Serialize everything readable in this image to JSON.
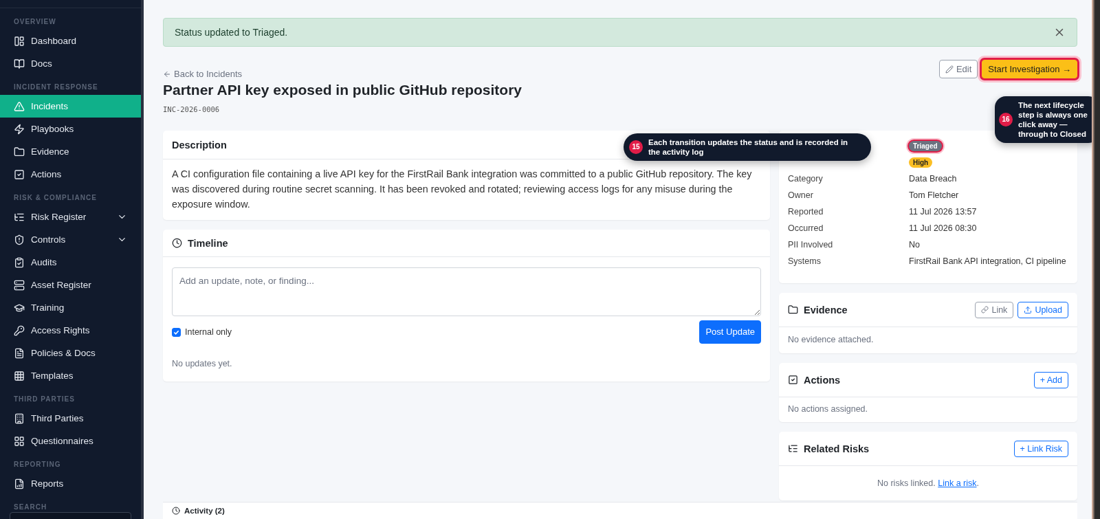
{
  "sidebar": {
    "sections": [
      {
        "title": "OVERVIEW",
        "items": [
          {
            "label": "Dashboard",
            "selected": false
          },
          {
            "label": "Docs",
            "selected": false
          }
        ]
      },
      {
        "title": "INCIDENT RESPONSE",
        "items": [
          {
            "label": "Incidents",
            "selected": true
          },
          {
            "label": "Playbooks",
            "selected": false
          },
          {
            "label": "Evidence",
            "selected": false
          },
          {
            "label": "Actions",
            "selected": false
          }
        ]
      },
      {
        "title": "RISK & COMPLIANCE",
        "items": [
          {
            "label": "Risk Register",
            "selected": false,
            "expanded": false
          },
          {
            "label": "Controls",
            "selected": false,
            "expanded": false
          },
          {
            "label": "Audits",
            "selected": false
          },
          {
            "label": "Asset Register",
            "selected": false
          },
          {
            "label": "Training",
            "selected": false
          },
          {
            "label": "Access Rights",
            "selected": false
          },
          {
            "label": "Policies & Docs",
            "selected": false
          },
          {
            "label": "Templates",
            "selected": false
          }
        ]
      },
      {
        "title": "THIRD PARTIES",
        "items": [
          {
            "label": "Third Parties",
            "selected": false
          },
          {
            "label": "Questionnaires",
            "selected": false
          }
        ]
      },
      {
        "title": "REPORTING",
        "items": [
          {
            "label": "Reports",
            "selected": false
          }
        ]
      },
      {
        "title": "SEARCH"
      }
    ]
  },
  "alert": {
    "message": "Status updated to Triaged."
  },
  "header": {
    "back_link": "Back to Incidents",
    "title": "Partner API key exposed in public GitHub repository",
    "incident_id": "INC-2026-0006",
    "buttons": [
      {
        "label": "Edit",
        "kind": "secondary",
        "highlighted": false
      },
      {
        "label": "Start Investigation →",
        "kind": "primary",
        "highlighted": true
      }
    ]
  },
  "description": {
    "title": "Description",
    "text": "A CI configuration file containing a live API key for the FirstRail Bank integration was committed to a public GitHub repository. The key was discovered during routine secret scanning. It has been revoked and rotated; reviewing access logs for any misuse during the exposure window."
  },
  "timeline": {
    "title": "Timeline",
    "placeholder": "Add an update, note, or finding...",
    "internal_only": {
      "label": "Internal only",
      "checked": true
    },
    "post_button": "Post Update",
    "empty": "No updates yet."
  },
  "details": [
    {
      "kind": "badge",
      "value": "Triaged",
      "color": "#6b7280",
      "highlighted": true
    },
    {
      "kind": "badge",
      "value": "High",
      "color": "#fbbf24",
      "highlighted": false
    },
    {
      "kind": "text",
      "label": "Category",
      "value": "Data Breach"
    },
    {
      "kind": "text",
      "label": "Owner",
      "value": "Tom Fletcher"
    },
    {
      "kind": "text",
      "label": "Reported",
      "value": "11 Jul 2026 13:57"
    },
    {
      "kind": "text",
      "label": "Occurred",
      "value": "11 Jul 2026 08:30"
    },
    {
      "kind": "text",
      "label": "PII Involved",
      "value": "No"
    },
    {
      "kind": "text",
      "label": "Systems",
      "value": "FirstRail Bank API integration, CI pipeline"
    }
  ],
  "evidence": {
    "title": "Evidence",
    "buttons": [
      {
        "label": "Link",
        "kind": "secondary"
      },
      {
        "label": "Upload",
        "kind": "outline"
      }
    ],
    "empty": "No evidence attached."
  },
  "actions": {
    "title": "Actions",
    "buttons": [
      {
        "label": "+ Add",
        "kind": "outline"
      }
    ],
    "empty": "No actions assigned."
  },
  "related_risks": {
    "title": "Related Risks",
    "buttons": [
      {
        "label": "+ Link Risk",
        "kind": "outline"
      }
    ],
    "empty": "No risks linked.",
    "link": "Link a risk",
    "after_link": "."
  },
  "activity": {
    "title": "Activity (2)"
  },
  "tooltips": [
    {
      "number": "15",
      "text": "Each transition updates the **status** and is recorded in the activity log"
    },
    {
      "number": "16",
      "text": "The **next lifecycle step** is always one click away — through to Closed"
    }
  ]
}
